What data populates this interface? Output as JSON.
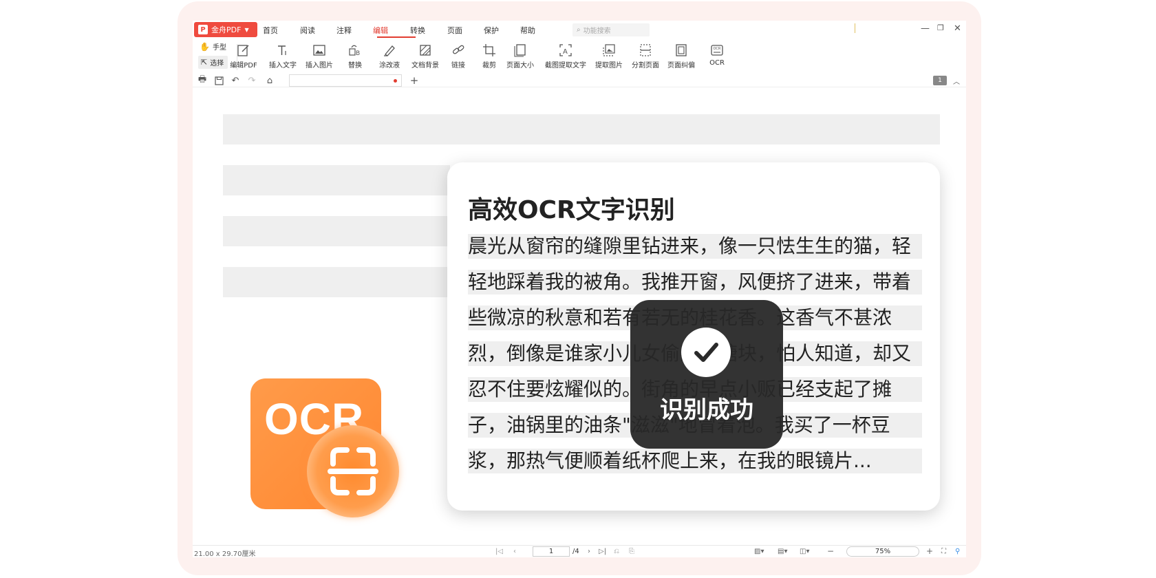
{
  "menubar": {
    "brand_label": "金舟PDF",
    "items": [
      "首页",
      "阅读",
      "注释",
      "编辑",
      "转换",
      "页面",
      "保护",
      "帮助"
    ],
    "active_index": 3,
    "search_placeholder": "功能搜索"
  },
  "toolbar": {
    "hand_label": "手型",
    "select_label": "选择",
    "tools": [
      {
        "label": "编辑PDF",
        "icon": "edit-pdf-icon"
      },
      {
        "label": "插入文字",
        "icon": "insert-text-icon"
      },
      {
        "label": "插入图片",
        "icon": "insert-image-icon"
      },
      {
        "label": "替换",
        "icon": "replace-icon"
      },
      {
        "label": "涂改液",
        "icon": "correction-fluid-icon"
      },
      {
        "label": "文档背景",
        "icon": "doc-background-icon"
      },
      {
        "label": "链接",
        "icon": "link-icon"
      },
      {
        "label": "裁剪",
        "icon": "crop-icon"
      },
      {
        "label": "页面大小",
        "icon": "page-size-icon"
      },
      {
        "label": "截图提取文字",
        "icon": "screenshot-ocr-icon"
      },
      {
        "label": "提取图片",
        "icon": "extract-image-icon"
      },
      {
        "label": "分割页面",
        "icon": "split-page-icon"
      },
      {
        "label": "页面纠偏",
        "icon": "deskew-icon"
      },
      {
        "label": "OCR",
        "icon": "ocr-tool-icon"
      }
    ]
  },
  "quickbar": {
    "page_badge": "1"
  },
  "card": {
    "title": "高效OCR文字识别",
    "lines": [
      "晨光从窗帘的缝隙里钻进来，像一只怯生生的猫，轻",
      "轻地踩着我的被角。我推开窗，风便挤了进来，带着",
      "些微凉的秋意和若有若无的桂花香。这香气不甚浓",
      "烈，倒像是谁家小儿女偷藏的糖块，怕人知道，却又",
      "忍不住要炫耀似的。街角的早点小贩已经支起了摊",
      "子，油锅里的油条\"滋滋\"地冒着泡。我买了一杯豆",
      "浆，那热气便顺着纸杯爬上来，在我的眼镜片..."
    ]
  },
  "logo": {
    "text": "OCR"
  },
  "toast": {
    "message": "识别成功"
  },
  "status": {
    "page_size": "21.00 x 29.70厘米",
    "current_page": "1",
    "total_pages": "/4",
    "zoom": "75%"
  },
  "colors": {
    "accent": "#e23c30",
    "brand": "#ef4b3f",
    "ocr_orange": "#ff8f3a"
  }
}
